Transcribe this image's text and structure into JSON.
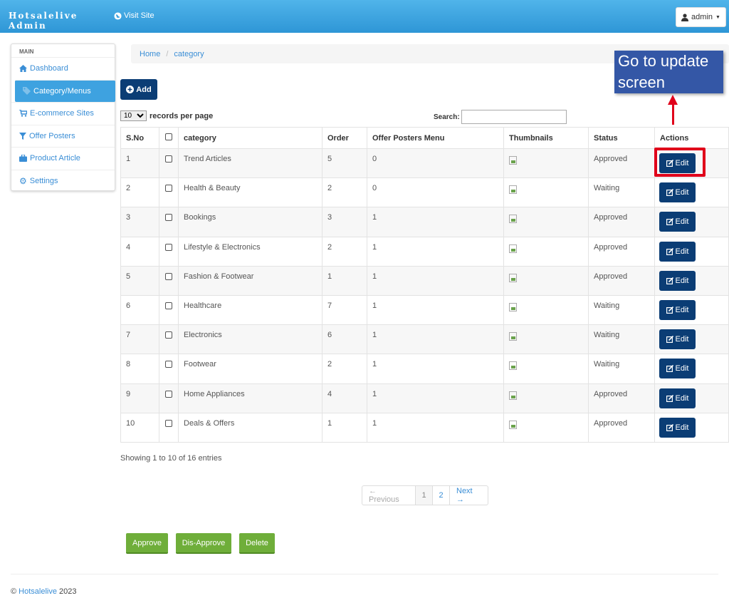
{
  "header": {
    "brand_line1": "Hotsalelive",
    "brand_line2": "Admin",
    "visit_site": "Visit Site",
    "user_label": "admin"
  },
  "sidebar": {
    "heading": "MAIN",
    "items": [
      {
        "label": "Dashboard",
        "icon": "home-icon"
      },
      {
        "label": "Category/Menus",
        "icon": "tag-icon"
      },
      {
        "label": "E-commerce Sites",
        "icon": "cart-icon"
      },
      {
        "label": "Offer Posters",
        "icon": "filter-icon"
      },
      {
        "label": "Product Article",
        "icon": "briefcase-icon"
      },
      {
        "label": "Settings",
        "icon": "gear-icon"
      }
    ]
  },
  "breadcrumb": {
    "home": "Home",
    "sep": "/",
    "current": "category"
  },
  "callout": {
    "line1": "Go to update",
    "line2": "screen"
  },
  "toolbar": {
    "add_label": "Add",
    "records_value": "10",
    "records_label": "records per page",
    "search_label": "Search:",
    "search_value": ""
  },
  "table": {
    "headers": [
      "S.No",
      "",
      "category",
      "Order",
      "Offer Posters Menu",
      "Thumbnails",
      "Status",
      "Actions"
    ],
    "edit_label": "Edit",
    "rows": [
      {
        "sno": "1",
        "category": "Trend Articles",
        "order": "5",
        "offer": "0",
        "status": "Approved"
      },
      {
        "sno": "2",
        "category": "Health & Beauty",
        "order": "2",
        "offer": "0",
        "status": "Waiting"
      },
      {
        "sno": "3",
        "category": "Bookings",
        "order": "3",
        "offer": "1",
        "status": "Approved"
      },
      {
        "sno": "4",
        "category": "Lifestyle & Electronics",
        "order": "2",
        "offer": "1",
        "status": "Approved"
      },
      {
        "sno": "5",
        "category": "Fashion & Footwear",
        "order": "1",
        "offer": "1",
        "status": "Approved"
      },
      {
        "sno": "6",
        "category": "Healthcare",
        "order": "7",
        "offer": "1",
        "status": "Waiting"
      },
      {
        "sno": "7",
        "category": "Electronics",
        "order": "6",
        "offer": "1",
        "status": "Waiting"
      },
      {
        "sno": "8",
        "category": "Footwear",
        "order": "2",
        "offer": "1",
        "status": "Waiting"
      },
      {
        "sno": "9",
        "category": "Home Appliances",
        "order": "4",
        "offer": "1",
        "status": "Approved"
      },
      {
        "sno": "10",
        "category": "Deals & Offers",
        "order": "1",
        "offer": "1",
        "status": "Approved"
      }
    ]
  },
  "summary": "Showing 1 to 10 of 16 entries",
  "pagination": {
    "prev": "← Previous",
    "pages": [
      "1",
      "2"
    ],
    "next": "Next →"
  },
  "actions": {
    "approve": "Approve",
    "disapprove": "Dis-Approve",
    "delete": "Delete"
  },
  "footer": {
    "copy": "©",
    "link": "Hotsalelive",
    "year": "2023"
  },
  "colors": {
    "topbar": "#3ea2e0",
    "navy_button": "#0b3d75",
    "green_button": "#6fae3a",
    "highlight": "#e0001a",
    "callout": "#3457a6"
  }
}
